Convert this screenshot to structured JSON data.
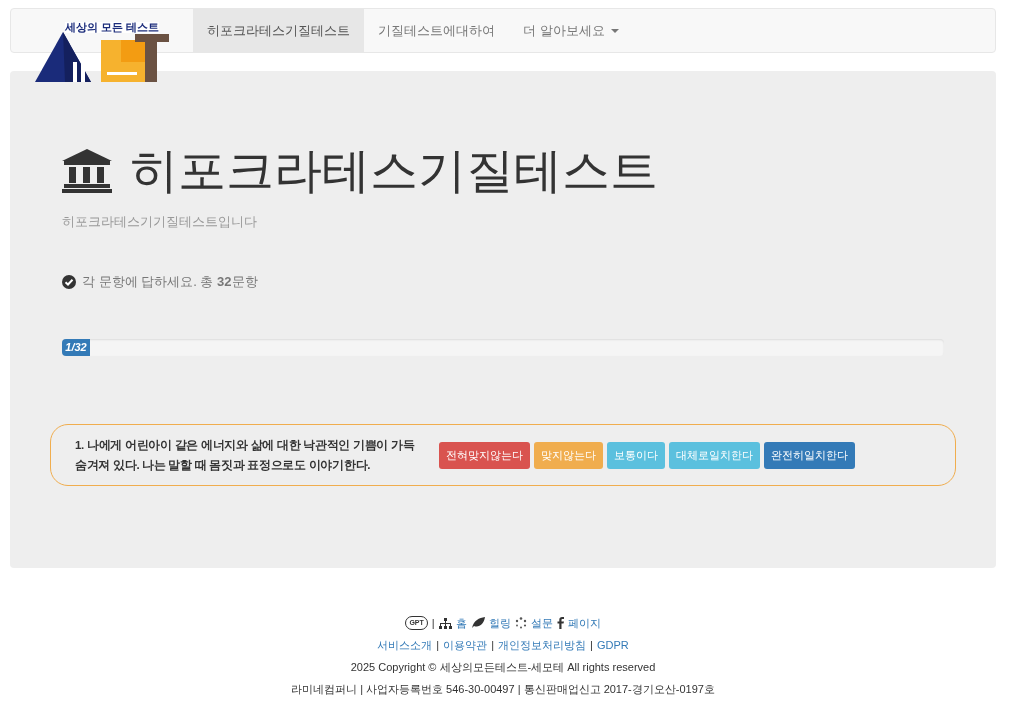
{
  "logo": {
    "text": "세상의 모든 테스트"
  },
  "nav": {
    "items": [
      {
        "label": "히포크라테스기질테스트",
        "selected": true,
        "dropdown": false
      },
      {
        "label": "기질테스트에대하여",
        "selected": false,
        "dropdown": false
      },
      {
        "label": "더 알아보세요",
        "selected": false,
        "dropdown": true
      }
    ]
  },
  "hero": {
    "title": "히포크라테스기질테스트",
    "subtitle": "히포크라테스기기질테스트입니다",
    "instruction": "각 문항에 답하세요. 총 **32**문항",
    "progress": {
      "label": "1/32",
      "level": 0.03
    }
  },
  "question": {
    "text": "1. 나에게 어린아이 같은 에너지와 삶에 대한 낙관적인 기쁨이 가득 숨겨져 있다. 나는 말할 때 몸짓과 표정으로도 이야기한다.",
    "options": [
      {
        "label": "전혀맞지않는다",
        "color": "#d9534f"
      },
      {
        "label": "맞지않는다",
        "color": "#f0ad4e"
      },
      {
        "label": "보통이다",
        "color": "#5bc0de"
      },
      {
        "label": "대체로일치한다",
        "color": "#5bc0de"
      },
      {
        "label": "완전히일치한다",
        "color": "#337ab7"
      }
    ]
  },
  "footer": {
    "gpt": "GPT",
    "separator": "|",
    "links": [
      "홈",
      "힐링",
      "설문",
      "페이지"
    ],
    "policy": [
      "서비스소개",
      "이용약관",
      "개인정보처리방침",
      "GDPR"
    ],
    "copyright": "2025 Copyright © 세상의모든테스트-세모테 All rights reserved",
    "company": "라미네컴퍼니 | 사업자등록번호 546-30-00497 | 통신판매업신고 2017-경기오산-0197호"
  }
}
